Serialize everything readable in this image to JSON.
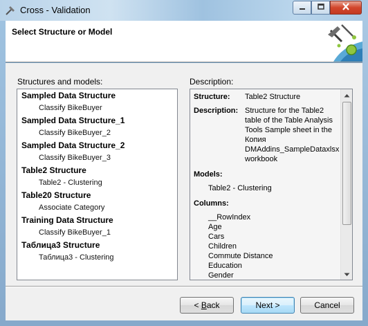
{
  "window": {
    "title": "Cross - Validation"
  },
  "header": {
    "title": "Select Structure or Model"
  },
  "structures": {
    "label": "Structures and models:",
    "items": [
      {
        "name": "Sampled Data Structure",
        "model": "Classify BikeBuyer"
      },
      {
        "name": "Sampled Data Structure_1",
        "model": "Classify BikeBuyer_2"
      },
      {
        "name": "Sampled Data Structure_2",
        "model": "Classify BikeBuyer_3"
      },
      {
        "name": "Table2 Structure",
        "model": "Table2 - Clustering"
      },
      {
        "name": "Table20 Structure",
        "model": "Associate Category"
      },
      {
        "name": "Training Data Structure",
        "model": "Classify BikeBuyer_1"
      },
      {
        "name": "Таблица3 Structure",
        "model": "Таблица3 - Clustering"
      }
    ]
  },
  "description": {
    "label": "Description:",
    "structure_key": "Structure:",
    "structure_value": "Table2 Structure",
    "description_key": "Description:",
    "description_value": "Structure for the Table2 table of the Table Analysis Tools Sample sheet in the Копия DMAddins_SampleDataxlsx workbook",
    "models_heading": "Models:",
    "models": [
      "Table2 - Clustering"
    ],
    "columns_heading": "Columns:",
    "columns": [
      "__RowIndex",
      "Age",
      "Cars",
      "Children",
      "Commute Distance",
      "Education",
      "Gender"
    ]
  },
  "buttons": {
    "back_prefix": "< ",
    "back_accel": "B",
    "back_rest": "ack",
    "next": "Next >",
    "cancel": "Cancel"
  },
  "colors": {
    "accent": "#3c7fb1",
    "close": "#c33a22"
  },
  "icons": [
    "tools-icon",
    "minimize-icon",
    "maximize-icon",
    "close-icon",
    "wizard-logo-icon",
    "scroll-up-icon",
    "scroll-down-icon"
  ]
}
